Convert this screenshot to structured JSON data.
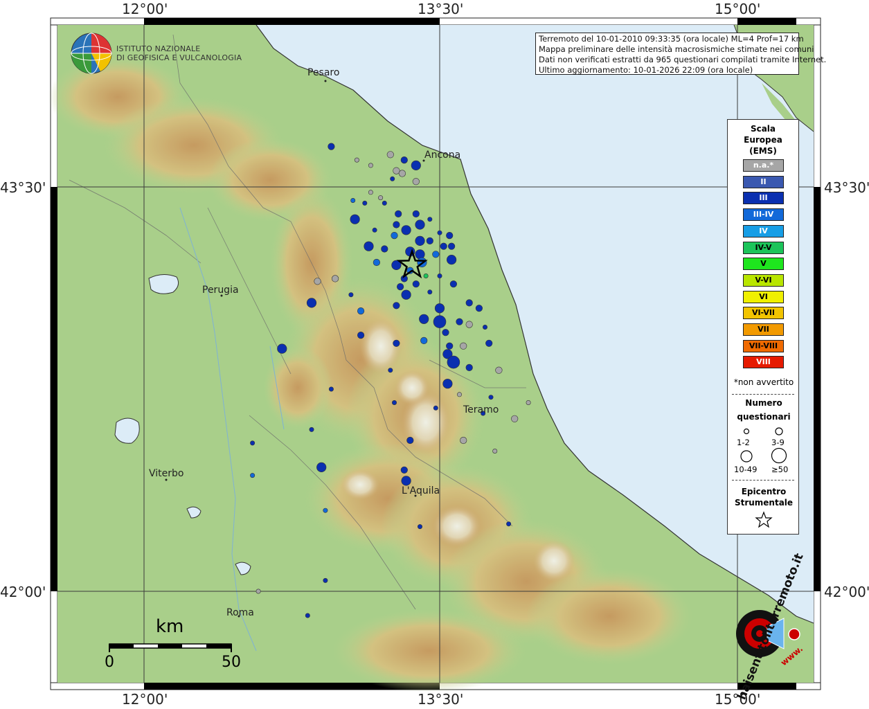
{
  "map": {
    "lon_labels": [
      "12°00'",
      "13°30'",
      "15°00'"
    ],
    "lat_labels": [
      "43°30'",
      "42°00'"
    ],
    "colors": {
      "sea": "#dcecf7",
      "land_low": "#a9cf8a",
      "land_mid": "#d6c183",
      "land_high": "#c79a5a",
      "grid": "#3a3a3a"
    }
  },
  "institute": {
    "line1": "ISTITUTO NAZIONALE",
    "line2": "DI GEOFISICA E VULCANOLOGIA"
  },
  "info": {
    "line1": "Terremoto del 10-01-2010 09:33:35 (ora locale) ML=4 Prof=17 km",
    "line2": "Mappa preliminare delle intensità macrosismiche stimate nei comuni",
    "line3": "Dati non verificati estratti da 965 questionari compilati tramite Internet.",
    "line4": "Ultimo aggiornamento: 10-01-2026 22:09 (ora locale)"
  },
  "legend": {
    "title": [
      "Scala",
      "Europea",
      "(EMS)"
    ],
    "classes": [
      {
        "label": "n.a.*",
        "color": "#a6a6a6"
      },
      {
        "label": "II",
        "color": "#3a58b0"
      },
      {
        "label": "III",
        "color": "#0a2fb0"
      },
      {
        "label": "III-IV",
        "color": "#1269d9"
      },
      {
        "label": "IV",
        "color": "#179ee6"
      },
      {
        "label": "IV-V",
        "color": "#1cc45a"
      },
      {
        "label": "V",
        "color": "#1ee61e"
      },
      {
        "label": "V-VI",
        "color": "#b9e600"
      },
      {
        "label": "VI",
        "color": "#f0f000"
      },
      {
        "label": "VI-VII",
        "color": "#f2c400"
      },
      {
        "label": "VII",
        "color": "#f29a00"
      },
      {
        "label": "VII-VIII",
        "color": "#f06a00"
      },
      {
        "label": "VIII",
        "color": "#e61a00"
      }
    ],
    "note": "*non avvertito",
    "count_title": [
      "Numero",
      "questionari"
    ],
    "count_classes": [
      "1-2",
      "3-9",
      "10-49",
      "≥50"
    ],
    "epicenter_title": [
      "Epicentro",
      "Strumentale"
    ]
  },
  "cities": [
    {
      "name": "Pesaro"
    },
    {
      "name": "Ancona"
    },
    {
      "name": "Perugia"
    },
    {
      "name": "Teramo"
    },
    {
      "name": "Viterbo"
    },
    {
      "name": "L'Aquila"
    },
    {
      "name": "Roma"
    }
  ],
  "scale_bar": {
    "unit": "km",
    "start": "0",
    "end": "50"
  },
  "watermark": {
    "text": "haisentitoilterremoto.it",
    "url": "www."
  },
  "chart_data": {
    "type": "scatter",
    "title": "Terremoto del 10-01-2010 09:33:35 (ora locale) ML=4 Prof=17 km",
    "xlabel": "",
    "ylabel": "",
    "epicenter": {
      "lon": 13.36,
      "lat": 43.21
    },
    "xlim": [
      11.27,
      15.19
    ],
    "ylim": [
      41.84,
      43.71
    ],
    "intensity_classes": [
      "n.a.",
      "II",
      "III",
      "III-IV",
      "IV",
      "IV-V"
    ],
    "points": [
      {
        "lon": 12.95,
        "lat": 43.65,
        "i": "III",
        "n": 2
      },
      {
        "lon": 13.08,
        "lat": 43.6,
        "i": "n.a.",
        "n": 1
      },
      {
        "lon": 13.15,
        "lat": 43.58,
        "i": "n.a.",
        "n": 1
      },
      {
        "lon": 13.25,
        "lat": 43.62,
        "i": "n.a.",
        "n": 2
      },
      {
        "lon": 13.32,
        "lat": 43.6,
        "i": "III",
        "n": 2
      },
      {
        "lon": 13.38,
        "lat": 43.58,
        "i": "III",
        "n": 3
      },
      {
        "lon": 13.28,
        "lat": 43.56,
        "i": "n.a.",
        "n": 2
      },
      {
        "lon": 13.31,
        "lat": 43.55,
        "i": "n.a.",
        "n": 2
      },
      {
        "lon": 13.26,
        "lat": 43.53,
        "i": "III",
        "n": 1
      },
      {
        "lon": 13.38,
        "lat": 43.52,
        "i": "n.a.",
        "n": 2
      },
      {
        "lon": 13.15,
        "lat": 43.48,
        "i": "n.a.",
        "n": 1
      },
      {
        "lon": 13.2,
        "lat": 43.46,
        "i": "n.a.",
        "n": 1
      },
      {
        "lon": 13.22,
        "lat": 43.44,
        "i": "III",
        "n": 1
      },
      {
        "lon": 13.06,
        "lat": 43.45,
        "i": "III-IV",
        "n": 1
      },
      {
        "lon": 13.12,
        "lat": 43.44,
        "i": "III",
        "n": 1
      },
      {
        "lon": 13.29,
        "lat": 43.4,
        "i": "III",
        "n": 2
      },
      {
        "lon": 13.38,
        "lat": 43.4,
        "i": "III",
        "n": 2
      },
      {
        "lon": 13.45,
        "lat": 43.38,
        "i": "III",
        "n": 1
      },
      {
        "lon": 13.4,
        "lat": 43.36,
        "i": "III",
        "n": 3
      },
      {
        "lon": 13.28,
        "lat": 43.36,
        "i": "III",
        "n": 2
      },
      {
        "lon": 13.07,
        "lat": 43.38,
        "i": "III",
        "n": 3
      },
      {
        "lon": 13.17,
        "lat": 43.34,
        "i": "III",
        "n": 1
      },
      {
        "lon": 13.33,
        "lat": 43.34,
        "i": "III",
        "n": 3
      },
      {
        "lon": 13.27,
        "lat": 43.32,
        "i": "III-IV",
        "n": 2
      },
      {
        "lon": 13.4,
        "lat": 43.3,
        "i": "III",
        "n": 3
      },
      {
        "lon": 13.5,
        "lat": 43.33,
        "i": "III",
        "n": 1
      },
      {
        "lon": 13.55,
        "lat": 43.32,
        "i": "III",
        "n": 2
      },
      {
        "lon": 13.45,
        "lat": 43.3,
        "i": "III",
        "n": 2
      },
      {
        "lon": 13.52,
        "lat": 43.28,
        "i": "III",
        "n": 2
      },
      {
        "lon": 13.56,
        "lat": 43.28,
        "i": "III",
        "n": 2
      },
      {
        "lon": 13.14,
        "lat": 43.28,
        "i": "III",
        "n": 3
      },
      {
        "lon": 13.22,
        "lat": 43.27,
        "i": "III",
        "n": 2
      },
      {
        "lon": 13.35,
        "lat": 43.26,
        "i": "III",
        "n": 3
      },
      {
        "lon": 13.4,
        "lat": 43.25,
        "i": "III",
        "n": 3
      },
      {
        "lon": 13.48,
        "lat": 43.25,
        "i": "III-IV",
        "n": 2
      },
      {
        "lon": 13.56,
        "lat": 43.23,
        "i": "III",
        "n": 3
      },
      {
        "lon": 13.18,
        "lat": 43.22,
        "i": "III-IV",
        "n": 2
      },
      {
        "lon": 13.28,
        "lat": 43.21,
        "i": "III",
        "n": 3
      },
      {
        "lon": 13.41,
        "lat": 43.22,
        "i": "III-IV",
        "n": 3
      },
      {
        "lon": 13.35,
        "lat": 43.19,
        "i": "III-IV",
        "n": 2
      },
      {
        "lon": 13.43,
        "lat": 43.17,
        "i": "IV-V",
        "n": 1
      },
      {
        "lon": 13.5,
        "lat": 43.17,
        "i": "III",
        "n": 1
      },
      {
        "lon": 13.32,
        "lat": 43.16,
        "i": "III",
        "n": 2
      },
      {
        "lon": 13.38,
        "lat": 43.14,
        "i": "III",
        "n": 2
      },
      {
        "lon": 13.3,
        "lat": 43.13,
        "i": "III",
        "n": 2
      },
      {
        "lon": 13.57,
        "lat": 43.14,
        "i": "III",
        "n": 2
      },
      {
        "lon": 13.33,
        "lat": 43.1,
        "i": "III",
        "n": 3
      },
      {
        "lon": 13.45,
        "lat": 43.11,
        "i": "III",
        "n": 1
      },
      {
        "lon": 12.97,
        "lat": 43.16,
        "i": "n.a.",
        "n": 2
      },
      {
        "lon": 12.88,
        "lat": 43.15,
        "i": "n.a.",
        "n": 2
      },
      {
        "lon": 12.85,
        "lat": 43.07,
        "i": "III",
        "n": 3
      },
      {
        "lon": 13.05,
        "lat": 43.1,
        "i": "III",
        "n": 1
      },
      {
        "lon": 13.1,
        "lat": 43.04,
        "i": "III-IV",
        "n": 2
      },
      {
        "lon": 13.28,
        "lat": 43.06,
        "i": "III",
        "n": 2
      },
      {
        "lon": 13.5,
        "lat": 43.05,
        "i": "III",
        "n": 3
      },
      {
        "lon": 13.65,
        "lat": 43.07,
        "i": "III",
        "n": 2
      },
      {
        "lon": 13.7,
        "lat": 43.05,
        "i": "III",
        "n": 2
      },
      {
        "lon": 13.42,
        "lat": 43.01,
        "i": "III",
        "n": 3
      },
      {
        "lon": 13.5,
        "lat": 43.0,
        "i": "III",
        "n": 4
      },
      {
        "lon": 13.6,
        "lat": 43.0,
        "i": "III",
        "n": 2
      },
      {
        "lon": 13.53,
        "lat": 42.96,
        "i": "III",
        "n": 2
      },
      {
        "lon": 13.65,
        "lat": 42.99,
        "i": "n.a.",
        "n": 2
      },
      {
        "lon": 13.73,
        "lat": 42.98,
        "i": "III",
        "n": 1
      },
      {
        "lon": 13.1,
        "lat": 42.95,
        "i": "III",
        "n": 2
      },
      {
        "lon": 13.28,
        "lat": 42.92,
        "i": "III",
        "n": 2
      },
      {
        "lon": 13.42,
        "lat": 42.93,
        "i": "III-IV",
        "n": 2
      },
      {
        "lon": 13.55,
        "lat": 42.91,
        "i": "III",
        "n": 2
      },
      {
        "lon": 13.62,
        "lat": 42.91,
        "i": "n.a.",
        "n": 2
      },
      {
        "lon": 13.75,
        "lat": 42.92,
        "i": "III",
        "n": 2
      },
      {
        "lon": 13.54,
        "lat": 42.88,
        "i": "III",
        "n": 3
      },
      {
        "lon": 13.57,
        "lat": 42.85,
        "i": "III",
        "n": 4
      },
      {
        "lon": 13.65,
        "lat": 42.83,
        "i": "III",
        "n": 2
      },
      {
        "lon": 13.8,
        "lat": 42.82,
        "i": "n.a.",
        "n": 2
      },
      {
        "lon": 13.25,
        "lat": 42.82,
        "i": "III",
        "n": 1
      },
      {
        "lon": 13.54,
        "lat": 42.77,
        "i": "III",
        "n": 3
      },
      {
        "lon": 13.6,
        "lat": 42.73,
        "i": "n.a.",
        "n": 1
      },
      {
        "lon": 12.7,
        "lat": 42.9,
        "i": "III",
        "n": 3
      },
      {
        "lon": 12.95,
        "lat": 42.75,
        "i": "III",
        "n": 1
      },
      {
        "lon": 12.85,
        "lat": 42.6,
        "i": "III",
        "n": 1
      },
      {
        "lon": 13.35,
        "lat": 42.56,
        "i": "III",
        "n": 2
      },
      {
        "lon": 12.55,
        "lat": 42.55,
        "i": "III",
        "n": 1
      },
      {
        "lon": 12.9,
        "lat": 42.46,
        "i": "III",
        "n": 3
      },
      {
        "lon": 13.32,
        "lat": 42.45,
        "i": "III",
        "n": 2
      },
      {
        "lon": 13.33,
        "lat": 42.41,
        "i": "III",
        "n": 3
      },
      {
        "lon": 12.92,
        "lat": 42.3,
        "i": "III-IV",
        "n": 1
      },
      {
        "lon": 13.4,
        "lat": 42.24,
        "i": "III",
        "n": 1
      },
      {
        "lon": 13.85,
        "lat": 42.25,
        "i": "III",
        "n": 1
      },
      {
        "lon": 12.92,
        "lat": 42.04,
        "i": "III",
        "n": 1
      },
      {
        "lon": 12.58,
        "lat": 42.0,
        "i": "n.a.",
        "n": 1
      },
      {
        "lon": 12.83,
        "lat": 41.91,
        "i": "III",
        "n": 1
      },
      {
        "lon": 13.62,
        "lat": 42.56,
        "i": "n.a.",
        "n": 2
      },
      {
        "lon": 13.78,
        "lat": 42.52,
        "i": "n.a.",
        "n": 1
      },
      {
        "lon": 13.88,
        "lat": 42.64,
        "i": "n.a.",
        "n": 2
      },
      {
        "lon": 13.95,
        "lat": 42.7,
        "i": "n.a.",
        "n": 1
      },
      {
        "lon": 13.72,
        "lat": 42.66,
        "i": "III",
        "n": 1
      },
      {
        "lon": 13.76,
        "lat": 42.72,
        "i": "III",
        "n": 1
      },
      {
        "lon": 13.48,
        "lat": 42.68,
        "i": "III",
        "n": 1
      },
      {
        "lon": 13.27,
        "lat": 42.7,
        "i": "III",
        "n": 1
      },
      {
        "lon": 12.55,
        "lat": 42.43,
        "i": "III-IV",
        "n": 1
      }
    ]
  }
}
